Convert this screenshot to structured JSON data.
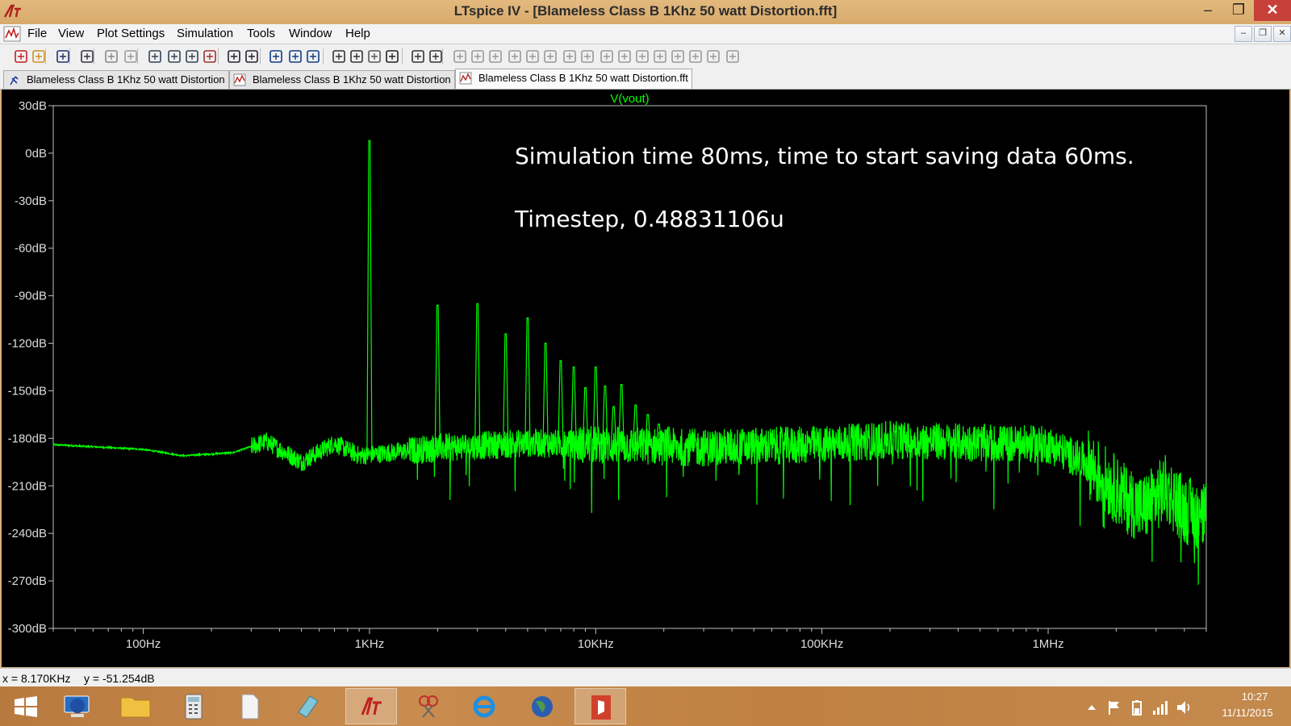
{
  "window": {
    "title": "LTspice IV - [Blameless Class B 1Khz 50 watt Distortion.fft]",
    "min_glyph": "–",
    "max_glyph": "❐",
    "close_glyph": "✕"
  },
  "menu": {
    "items": [
      "File",
      "View",
      "Plot Settings",
      "Simulation",
      "Tools",
      "Window",
      "Help"
    ],
    "mdi_min": "–",
    "mdi_restore": "❐",
    "mdi_close": "✕"
  },
  "toolbar": {
    "icons": [
      "new-schematic-icon",
      "open-icon",
      "save-icon",
      "control-panel-icon",
      "run-icon",
      "halt-icon",
      "zoom-in-icon",
      "zoom-out-icon",
      "zoom-extents-icon",
      "zoom-cancel-icon",
      "autorange-icon",
      "autorange-y-icon",
      "tile-horizontal-icon",
      "cascade-icon",
      "tile-vertical-icon",
      "cut-icon",
      "copy-icon",
      "paste-icon",
      "find-icon",
      "print-preview-icon",
      "print-icon",
      "wire-icon",
      "ground-icon",
      "label-net-icon",
      "resistor-icon",
      "capacitor-icon",
      "inductor-icon",
      "diode-icon",
      "component-icon",
      "move-icon",
      "drag-icon",
      "undo-icon",
      "redo-icon",
      "rotate-icon",
      "mirror-icon",
      "text-icon",
      "spice-directive-icon"
    ]
  },
  "tabs": [
    {
      "label": "Blameless Class B 1Khz 50 watt Distortion",
      "icon": "schematic-icon",
      "active": false
    },
    {
      "label": "Blameless Class B 1Khz 50 watt Distortion",
      "icon": "waveform-icon",
      "active": false
    },
    {
      "label": "Blameless Class B 1Khz 50 watt Distortion.fft",
      "icon": "waveform-icon",
      "active": true
    }
  ],
  "plot": {
    "trace_label": "V(vout)",
    "annotations": [
      "Simulation time 80ms, time to start saving data 60ms.",
      "Timestep, 0.48831106u"
    ],
    "colors": {
      "background": "#000000",
      "trace": "#00ff00",
      "axis": "#c0c0c0"
    }
  },
  "chart_data": {
    "type": "line",
    "title": "",
    "series": [
      {
        "name": "V(vout)"
      }
    ],
    "x_scale": "log",
    "xlim": [
      40,
      5000000
    ],
    "ylim": [
      -300,
      30
    ],
    "y_unit": "dB",
    "x_ticks": [
      {
        "value": 100,
        "label": "100Hz"
      },
      {
        "value": 1000,
        "label": "1KHz"
      },
      {
        "value": 10000,
        "label": "10KHz"
      },
      {
        "value": 100000,
        "label": "100KHz"
      },
      {
        "value": 1000000,
        "label": "1MHz"
      }
    ],
    "y_ticks": [
      {
        "value": 30,
        "label": "30dB"
      },
      {
        "value": 0,
        "label": "0dB"
      },
      {
        "value": -30,
        "label": "-30dB"
      },
      {
        "value": -60,
        "label": "-60dB"
      },
      {
        "value": -90,
        "label": "-90dB"
      },
      {
        "value": -120,
        "label": "-120dB"
      },
      {
        "value": -150,
        "label": "-150dB"
      },
      {
        "value": -180,
        "label": "-180dB"
      },
      {
        "value": -210,
        "label": "-210dB"
      },
      {
        "value": -240,
        "label": "-240dB"
      },
      {
        "value": -270,
        "label": "-270dB"
      },
      {
        "value": -300,
        "label": "-300dB"
      }
    ],
    "peaks": [
      {
        "x": 1000,
        "y": 8
      },
      {
        "x": 2000,
        "y": -96
      },
      {
        "x": 3000,
        "y": -95
      },
      {
        "x": 4000,
        "y": -114
      },
      {
        "x": 5000,
        "y": -104
      },
      {
        "x": 6000,
        "y": -120
      },
      {
        "x": 7000,
        "y": -131
      },
      {
        "x": 8000,
        "y": -135
      },
      {
        "x": 9000,
        "y": -148
      },
      {
        "x": 10000,
        "y": -135
      },
      {
        "x": 11000,
        "y": -147
      },
      {
        "x": 12000,
        "y": -160
      },
      {
        "x": 13000,
        "y": -146
      },
      {
        "x": 15000,
        "y": -159
      },
      {
        "x": 17000,
        "y": -165
      },
      {
        "x": 19000,
        "y": -171
      },
      {
        "x": 21000,
        "y": -173
      }
    ],
    "floor": [
      {
        "x": 40,
        "y": -184
      },
      {
        "x": 100,
        "y": -187
      },
      {
        "x": 150,
        "y": -191
      },
      {
        "x": 250,
        "y": -189
      },
      {
        "x": 350,
        "y": -182
      },
      {
        "x": 500,
        "y": -195
      },
      {
        "x": 700,
        "y": -183
      },
      {
        "x": 900,
        "y": -191
      },
      {
        "x": 2000,
        "y": -186
      },
      {
        "x": 5000,
        "y": -183
      },
      {
        "x": 10000,
        "y": -184
      },
      {
        "x": 30000,
        "y": -186
      },
      {
        "x": 100000,
        "y": -184
      },
      {
        "x": 200000,
        "y": -181
      },
      {
        "x": 500000,
        "y": -183
      },
      {
        "x": 1000000,
        "y": -184
      },
      {
        "x": 1500000,
        "y": -196
      },
      {
        "x": 2200000,
        "y": -218
      },
      {
        "x": 2600000,
        "y": -225
      },
      {
        "x": 3300000,
        "y": -212
      },
      {
        "x": 4000000,
        "y": -225
      },
      {
        "x": 5000000,
        "y": -230
      }
    ]
  },
  "status": {
    "cursor_x": "x = 8.170KHz",
    "cursor_y": "y = -51.254dB"
  },
  "taskbar": {
    "apps": [
      "windows-start-icon",
      "remote-desktop-icon",
      "file-explorer-icon",
      "calculator-icon",
      "document-icon",
      "notes-icon",
      "ltspice-icon",
      "snipping-tool-icon",
      "internet-explorer-icon",
      "globe-icon",
      "office-icon"
    ],
    "clock_time": "10:27",
    "clock_date": "11/11/2015"
  }
}
